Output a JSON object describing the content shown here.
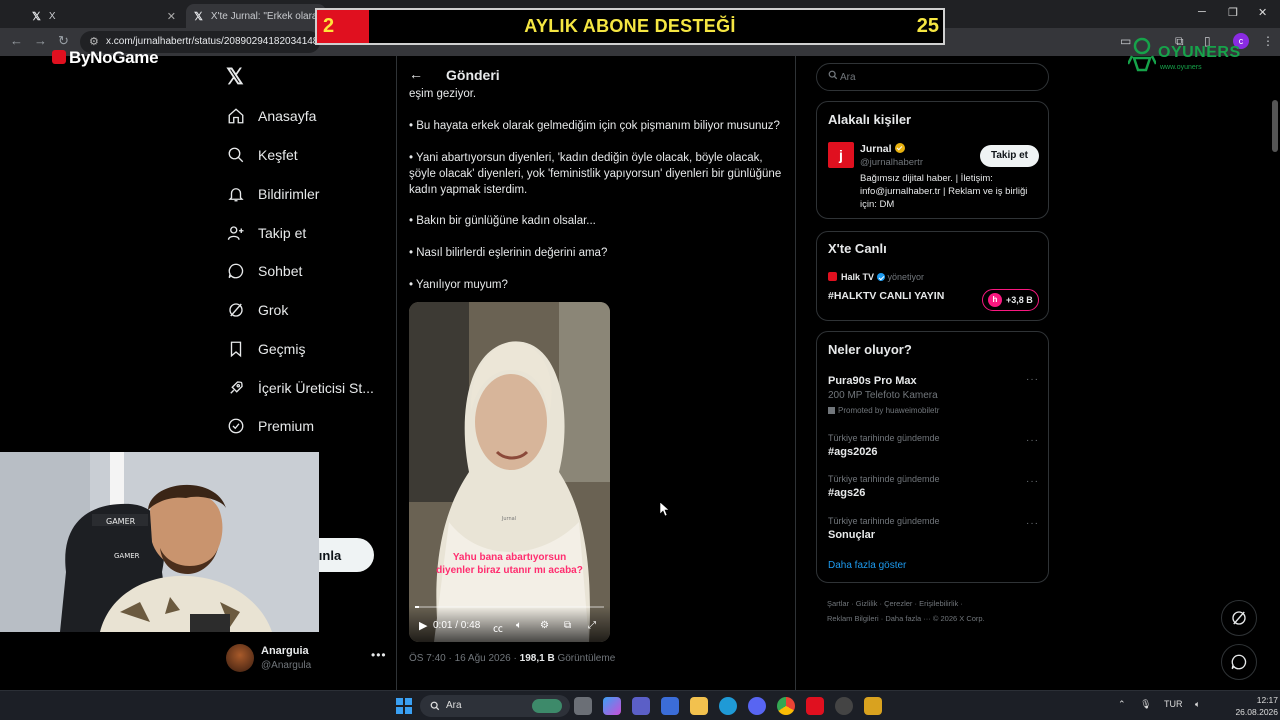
{
  "browser": {
    "tabs": [
      {
        "label": "X"
      },
      {
        "label": "X'te Jurnal: \"Erkek olarak doğ"
      }
    ],
    "url": "x.com/jurnalhabertr/status/2089029418203414823"
  },
  "overlay": {
    "banner_left": "2",
    "banner_title": "AYLIK ABONE DESTEĞİ",
    "banner_right": "25",
    "bynogame": "ByNoGame",
    "oyuners": "OYUNERS",
    "oyuners_sub": "www.oyuners"
  },
  "nav": {
    "items": [
      {
        "label": "Anasayfa",
        "icon": "home-icon"
      },
      {
        "label": "Keşfet",
        "icon": "search-icon"
      },
      {
        "label": "Bildirimler",
        "icon": "bell-icon"
      },
      {
        "label": "Takip et",
        "icon": "follow-icon"
      },
      {
        "label": "Sohbet",
        "icon": "chat-icon"
      },
      {
        "label": "Grok",
        "icon": "grok-icon"
      },
      {
        "label": "Geçmiş",
        "icon": "bookmark-icon"
      },
      {
        "label": "İçerik Üreticisi St...",
        "icon": "rocket-icon"
      },
      {
        "label": "Premium",
        "icon": "verified-icon"
      }
    ],
    "post_button_visible": "ınla"
  },
  "account": {
    "name": "Anarguia",
    "handle": "@Anargula"
  },
  "main": {
    "title": "Gönderi",
    "paragraphs": [
      "eşim geziyor.",
      "• Bu hayata erkek olarak gelmediğim için çok pişmanım biliyor musunuz?",
      "• Yani abartıyorsun diyenleri, 'kadın dediğin öyle olacak, böyle olacak, şöyle olacak' diyenleri, yok 'feministlik yapıyorsun' diyenleri bir günlüğüne kadın yapmak isterdim.",
      "• Bakın bir günlüğüne kadın olsalar...",
      "• Nasıl bilirlerdi eşlerinin değerini ama?",
      "• Yanılıyor muyum?"
    ],
    "video": {
      "caption": "Yahu bana abartıyorsun diyenler biraz utanır mı acaba?",
      "watermark": "Jurnal",
      "time": "0:01 / 0:48",
      "progress": 0.02
    },
    "meta_time": "ÖS 7:40 · 16 Ağu 2026 · ",
    "meta_views": "198,1 B",
    "meta_views_label": " Görüntüleme"
  },
  "sidebar": {
    "search_placeholder": "Ara",
    "related": {
      "title": "Alakalı kişiler",
      "name": "Jurnal",
      "handle": "@jurnalhabertr",
      "follow_label": "Takip et",
      "bio": "Bağımsız dijital haber. | İletişim: info@jurnalhaber.tr | Reklam ve iş birliği için: DM"
    },
    "live": {
      "title": "X'te Canlı",
      "host": "Halk TV",
      "host_role": "yönetiyor",
      "stream": "#HALKTV CANLI YAYIN",
      "listeners": "+3,8 B"
    },
    "trends": {
      "title": "Neler oluyor?",
      "promo_name": "Pura90s Pro Max",
      "promo_sub": "200 MP Telefoto Kamera",
      "promo_by": "Promoted by huaweimobiletr",
      "items": [
        {
          "category": "Türkiye tarihinde gündemde",
          "name": "#ags2026"
        },
        {
          "category": "Türkiye tarihinde gündemde",
          "name": "#ags26"
        },
        {
          "category": "Türkiye tarihinde gündemde",
          "name": "Sonuçlar"
        }
      ],
      "show_more": "Daha fazla göster"
    },
    "footer": {
      "line1": "Şartlar · Gizlilik · Çerezler · Erişilebilirlik ·",
      "line2": "Reklam Bilgileri · Daha fazla ··· © 2026 X Corp."
    }
  },
  "taskbar": {
    "search_placeholder": "Ara",
    "lang": "TUR",
    "time": "12:17",
    "date": "26.08.2026"
  },
  "colors": {
    "x_bg": "#000000",
    "banner_red": "#e0101f",
    "banner_yellow": "#f5e642",
    "link_blue": "#1d9bf0",
    "live_red": "#f91880"
  }
}
